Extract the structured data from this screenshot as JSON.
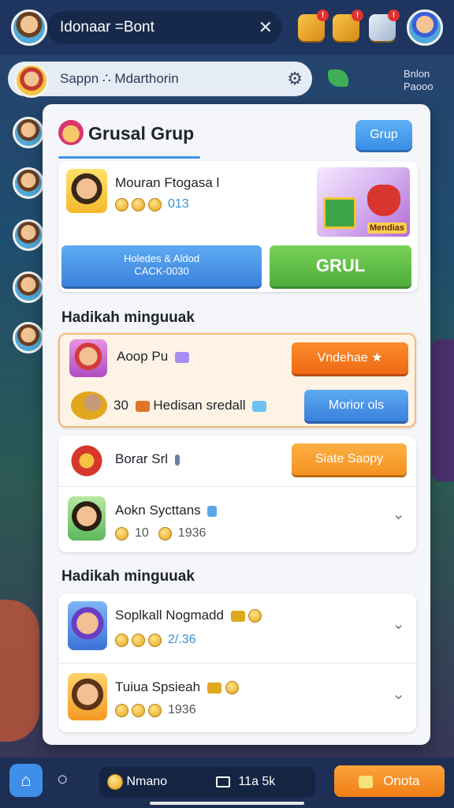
{
  "top_bar": {
    "username": "Idonaar =Bont",
    "close_glyph": "✕",
    "notif_count": "!"
  },
  "search_bar": {
    "text": "Sappn ∴ Mdarthorin",
    "gear_glyph": "⚙"
  },
  "side_label": {
    "line1": "Bnlon",
    "line2": "Paooo"
  },
  "modal": {
    "title": "Grusal Grup",
    "grup_button": "Grup",
    "top_card": {
      "name": "Mouran Ftogasa l",
      "coin_value": "013",
      "promo_label": "Mendias",
      "blue_button_line1": "Holedes & Aldod",
      "blue_button_line2": "CACK-0030",
      "green_button": "GRUL"
    },
    "section1_title": "Hadikah minguuak",
    "section1_rows": [
      {
        "name": "Aoop Pu",
        "button": "Vndehae ★"
      },
      {
        "name": "Hedisan sredall",
        "prefix": "30",
        "button": "Morior ols"
      }
    ],
    "section1b_rows": [
      {
        "name": "Borar Srl",
        "button": "Siate Saopy"
      },
      {
        "name": "Aokn Sycttans",
        "coin_value": "10",
        "coin_value2": "1936",
        "chevron": "⌄"
      }
    ],
    "section2_title": "Hadikah minguuak",
    "section2_rows": [
      {
        "name": "Soplkall Nogmadd",
        "coin_value": "2/.36",
        "chevron": "⌄"
      },
      {
        "name": "Tuiua Spsieah",
        "coin_value": "1936",
        "chevron": "⌄"
      }
    ]
  },
  "bottom_bar": {
    "home_glyph": "⌂",
    "chat_glyph": "○",
    "left_text": "Nmano",
    "right_text": "11a 5k",
    "create_button": "Onota"
  },
  "colors": {
    "primary_blue": "#3b82de",
    "green": "#4cae39",
    "orange": "#ef6a15",
    "background": "#27406e"
  }
}
